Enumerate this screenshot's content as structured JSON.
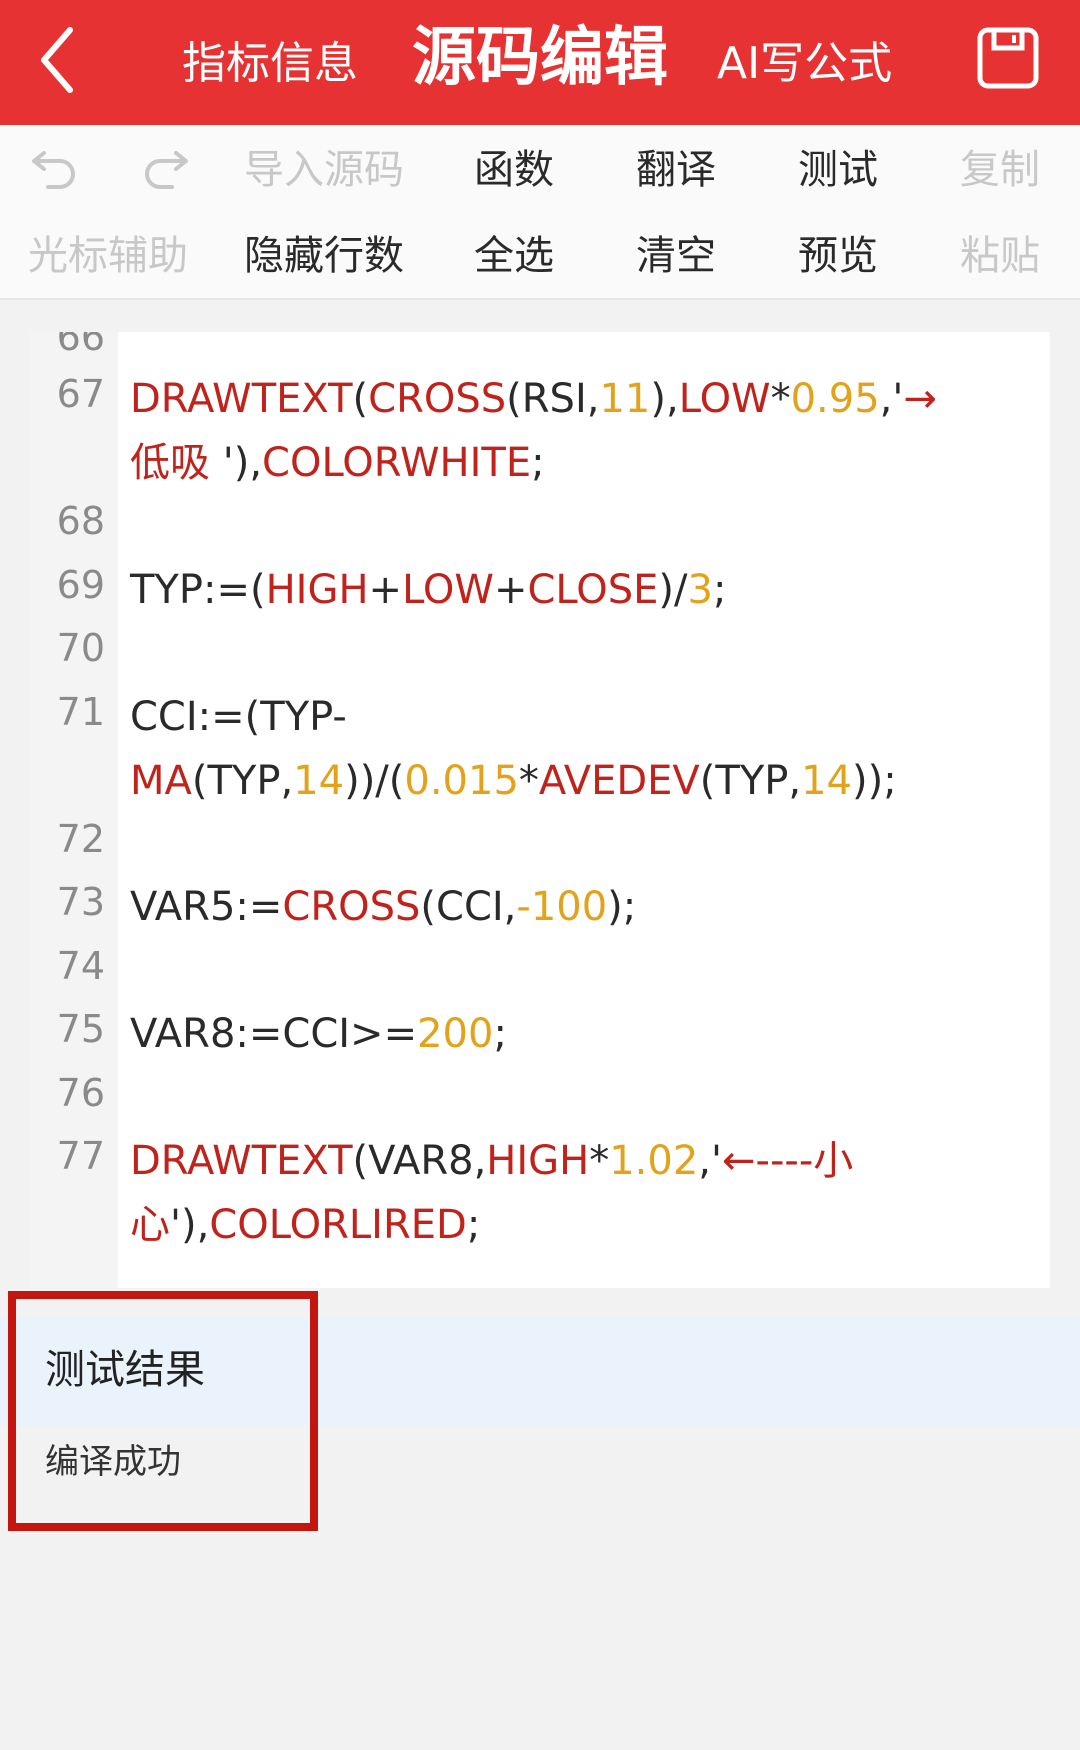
{
  "header": {
    "tab_info": "指标信息",
    "tab_source": "源码编辑",
    "tab_ai": "AI写公式",
    "back_icon": "chevron-left-icon",
    "save_icon": "save-icon",
    "accent": "#e63232"
  },
  "toolbar": {
    "undo_icon": "undo-icon",
    "redo_icon": "redo-icon",
    "import_source": "导入源码",
    "functions": "函数",
    "translate": "翻译",
    "test": "测试",
    "copy": "复制",
    "cursor_assist": "光标辅助",
    "hide_line_numbers": "隐藏行数",
    "select_all": "全选",
    "clear": "清空",
    "preview": "预览",
    "paste": "粘贴"
  },
  "editor": {
    "partial_line_number": "66",
    "line_numbers": [
      "67",
      "68",
      "69",
      "70",
      "71",
      "72",
      "73",
      "74",
      "75",
      "76",
      "77"
    ],
    "colors": {
      "keyword": "#c0221c",
      "number": "#e2a21a",
      "text": "#2a2a2a"
    }
  },
  "result": {
    "title": "测试结果",
    "message": "编译成功",
    "highlight_color": "#c2160f"
  }
}
